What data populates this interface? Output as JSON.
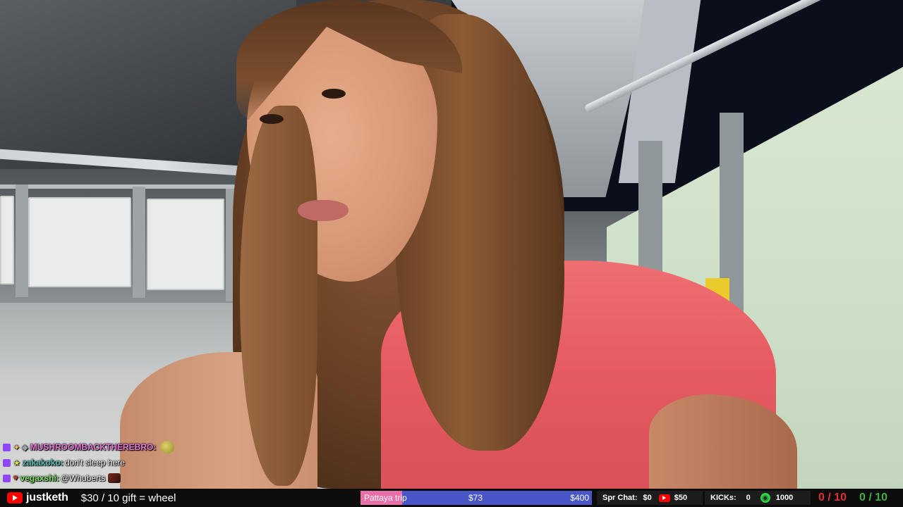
{
  "chat": [
    {
      "badges": [
        "twitch",
        "sparkle",
        "stone"
      ],
      "user": "MUSHROOMBACKTHEREBRO:",
      "user_color": "#e879d8",
      "message": "",
      "emote": "yellow-face-emote"
    },
    {
      "badges": [
        "twitch",
        "star"
      ],
      "user": "zakakoko:",
      "user_color": "#54c0b1",
      "message": "don't sleep here"
    },
    {
      "badges": [
        "twitch",
        "heart"
      ],
      "user": "vegaxshi:",
      "user_color": "#7fe36b",
      "message": "@Whuberts",
      "emote": "pixel-emote"
    }
  ],
  "bar": {
    "channel": "justketh",
    "goal_text": "$30 / 10 gift = wheel",
    "progress": {
      "label": "Pattaya trip",
      "current": "$73",
      "target": "$400",
      "fraction": 0.18
    },
    "spr_chat_label": "Spr Chat:",
    "spr_chat_value": "$0",
    "yt_value": "$50",
    "kicks_label": "KICKs:",
    "kicks_value": "0",
    "kick_goal": "1000",
    "counter_red": "0 / 10",
    "counter_green": "0 / 10",
    "colors": {
      "red": "#e03030",
      "green": "#36b33c",
      "progress_fill": "#ea6fa8",
      "progress_bg": "#4a55c8"
    }
  }
}
